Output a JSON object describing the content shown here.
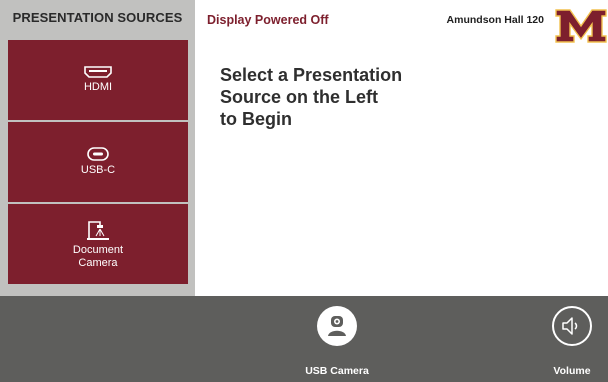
{
  "sidebar": {
    "title": "PRESENTATION SOURCES",
    "sources": [
      {
        "label": "HDMI",
        "icon": "hdmi-icon"
      },
      {
        "label": "USB-C",
        "icon": "usb-c-icon"
      },
      {
        "label": "Document\nCamera",
        "icon": "document-camera-icon"
      }
    ]
  },
  "header": {
    "status": "Display Powered Off",
    "room": "Amundson Hall 120",
    "logo_icon": "block-m-logo"
  },
  "main": {
    "prompt_lines": [
      "Select a Presentation",
      "Source on the Left",
      "to Begin"
    ]
  },
  "bottom_bar": {
    "usb_camera_label": "USB Camera",
    "usb_camera_icon": "webcam-icon",
    "volume_label": "Volume",
    "volume_icon": "speaker-icon"
  },
  "colors": {
    "maroon": "#7d1f2d",
    "gold": "#f2c14e",
    "sidebar_bg": "#c1c1bf",
    "bottom_bar_bg": "#5e5e5c"
  }
}
